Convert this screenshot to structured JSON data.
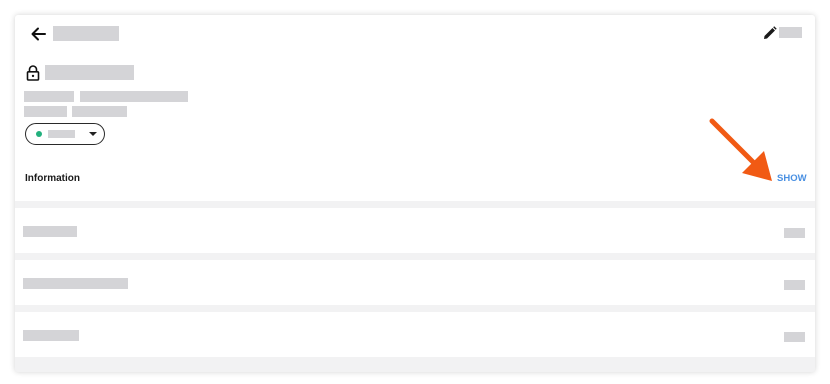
{
  "header": {
    "back_icon": "arrow-left-icon",
    "edit_icon": "pencil-icon",
    "lock_icon": "lock-icon"
  },
  "status": {
    "dot_color": "#22b07d",
    "caret_icon": "caret-down-icon"
  },
  "information": {
    "label": "Information",
    "show_label": "SHOW"
  },
  "colors": {
    "accent": "#4a90e2",
    "annotation_arrow": "#f15a14",
    "placeholder": "#d4d4d7"
  }
}
